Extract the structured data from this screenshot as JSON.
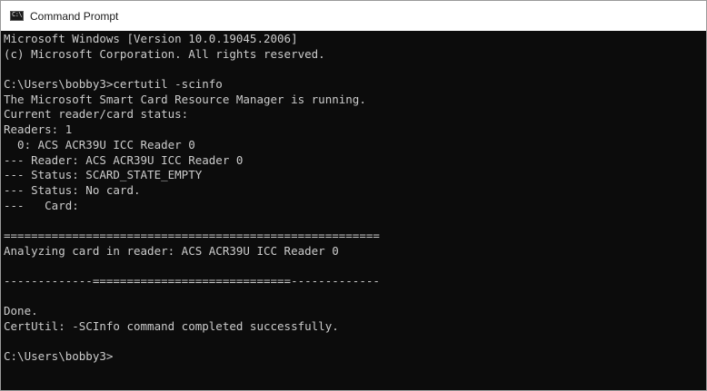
{
  "window": {
    "title": "Command Prompt",
    "icon": "command-prompt-icon",
    "icon_glyph": "C:\\",
    "colors": {
      "background": "#0c0c0c",
      "text": "#cccccc",
      "titlebar": "#ffffff"
    }
  },
  "console": {
    "lines": [
      "Microsoft Windows [Version 10.0.19045.2006]",
      "(c) Microsoft Corporation. All rights reserved.",
      "",
      "C:\\Users\\bobby3>certutil -scinfo",
      "The Microsoft Smart Card Resource Manager is running.",
      "Current reader/card status:",
      "Readers: 1",
      "  0: ACS ACR39U ICC Reader 0",
      "--- Reader: ACS ACR39U ICC Reader 0",
      "--- Status: SCARD_STATE_EMPTY",
      "--- Status: No card.",
      "---   Card:",
      "",
      "=======================================================",
      "Analyzing card in reader: ACS ACR39U ICC Reader 0",
      "",
      "-------------=============================-------------",
      "",
      "Done.",
      "CertUtil: -SCInfo command completed successfully.",
      "",
      "C:\\Users\\bobby3>"
    ]
  }
}
